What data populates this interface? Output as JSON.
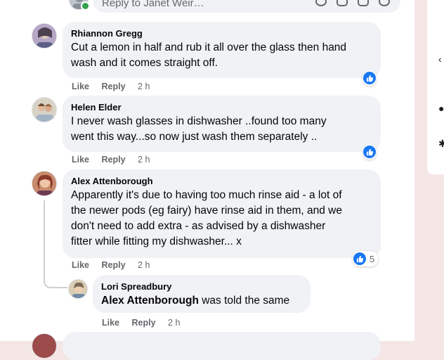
{
  "reply_box": {
    "placeholder": "Reply to Janet Weir…"
  },
  "comments": [
    {
      "author": "Rhiannon Gregg",
      "text": "Cut a lemon in half and rub it all over the glass then hand\nwash and it comes straight off.",
      "like_label": "Like",
      "reply_label": "Reply",
      "time": "2 h"
    },
    {
      "author": "Helen Elder",
      "text": "I never wash glasses in dishwasher ..found too many\nwent this way...so now just wash them separately ..",
      "like_label": "Like",
      "reply_label": "Reply",
      "time": "2 h"
    },
    {
      "author": "Alex Attenborough",
      "text": "Apparently it's due to having too much rinse aid - a lot of\nthe newer pods (eg fairy) have rinse aid in them, and we\ndon't need to add extra - as advised by a dishwasher\nfitter while fitting my dishwasher... x",
      "like_label": "Like",
      "reply_label": "Reply",
      "time": "2 h",
      "reaction_count": "5"
    }
  ],
  "reply": {
    "author": "Lori Spreadbury",
    "mention": "Alex Attenborough",
    "text": " was told the same",
    "like_label": "Like",
    "reply_label": "Reply",
    "time": "2 h"
  },
  "colors": {
    "like_blue": "#1877f2",
    "bubble": "#f0f2f5",
    "meta_gray": "#65676b",
    "page_bg": "#f5e6e6"
  }
}
